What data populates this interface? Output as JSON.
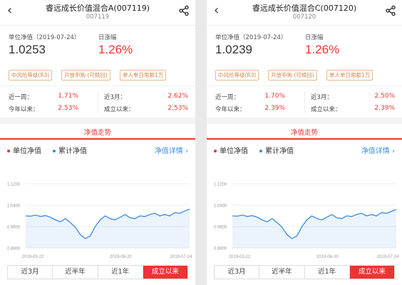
{
  "colors": {
    "red": "#e33",
    "blue": "#3a8be0",
    "tag": "#c98a4e"
  },
  "panels": [
    {
      "title": "睿远成长价值混合A(007119)",
      "code": "007119",
      "nav_label": "单位净值（2019-07-24）",
      "nav_value": "1.0253",
      "change_label": "日涨幅",
      "change_value": "1.26%",
      "tags": [
        "中风险等级(R3)",
        "开放申购 (可赎回)",
        "单人单日限额1万"
      ],
      "perf": [
        {
          "label": "近一周：",
          "value": "1.71%"
        },
        {
          "label": "近3月：",
          "value": "2.62%"
        },
        {
          "label": "今年以来：",
          "value": "2.53%"
        },
        {
          "label": "成立以来：",
          "value": "2.53%"
        }
      ],
      "trend_title": "净值走势",
      "legend": {
        "unit": "单位净值",
        "cum": "累计净值",
        "detail": "净值详情"
      },
      "ranges": [
        "近3月",
        "近半年",
        "近1年",
        "成立以来"
      ],
      "active_range": 3,
      "chart_data": {
        "type": "line",
        "series": [
          {
            "name": "累计净值",
            "values": [
              1.0,
              0.999,
              1.003,
              0.998,
              1.001,
              0.995,
              0.985,
              0.978,
              0.99,
              0.975,
              0.958,
              0.93,
              0.915,
              0.925,
              0.96,
              0.985,
              1.0,
              0.99,
              0.985,
              0.995,
              1.005,
              0.993,
              0.99,
              1.0,
              0.998,
              1.005,
              1.01,
              1.0,
              1.005,
              1.0,
              1.012,
              1.01,
              1.018,
              1.025
            ]
          }
        ],
        "y_ticks": [
          "1.1200",
          "1.0400",
          "0.9600",
          "0.8800"
        ],
        "ylim": [
          0.88,
          1.12
        ],
        "x_ticks": [
          "2019-03-22",
          "2019-06-20",
          "2019-07-24"
        ]
      }
    },
    {
      "title": "睿远成长价值混合C(007120)",
      "code": "007120",
      "nav_label": "单位净值（2019-07-24）",
      "nav_value": "1.0239",
      "change_label": "日涨幅",
      "change_value": "1.26%",
      "tags": [
        "中风险等级(R3)",
        "开放申购 (可赎回)",
        "单人单日限额1万"
      ],
      "perf": [
        {
          "label": "近一周：",
          "value": "1.70%"
        },
        {
          "label": "近3月：",
          "value": "2.50%"
        },
        {
          "label": "今年以来：",
          "value": "2.39%"
        },
        {
          "label": "成立以来：",
          "value": "2.39%"
        }
      ],
      "trend_title": "净值走势",
      "legend": {
        "unit": "单位净值",
        "cum": "累计净值",
        "detail": "净值详情"
      },
      "ranges": [
        "近3月",
        "近半年",
        "近1年",
        "成立以来"
      ],
      "active_range": 3,
      "chart_data": {
        "type": "line",
        "series": [
          {
            "name": "累计净值",
            "values": [
              1.0,
              0.999,
              1.003,
              0.998,
              1.001,
              0.995,
              0.985,
              0.978,
              0.99,
              0.975,
              0.958,
              0.93,
              0.915,
              0.925,
              0.96,
              0.985,
              1.0,
              0.99,
              0.985,
              0.995,
              1.005,
              0.993,
              0.99,
              1.0,
              0.998,
              1.005,
              1.01,
              1.0,
              1.005,
              1.0,
              1.012,
              1.01,
              1.017,
              1.024
            ]
          }
        ],
        "y_ticks": [
          "1.1200",
          "1.0400",
          "0.9600",
          "0.8800"
        ],
        "ylim": [
          0.88,
          1.12
        ],
        "x_ticks": [
          "2019-03-22",
          "2019-06-20",
          "2019-07-24"
        ]
      }
    }
  ]
}
